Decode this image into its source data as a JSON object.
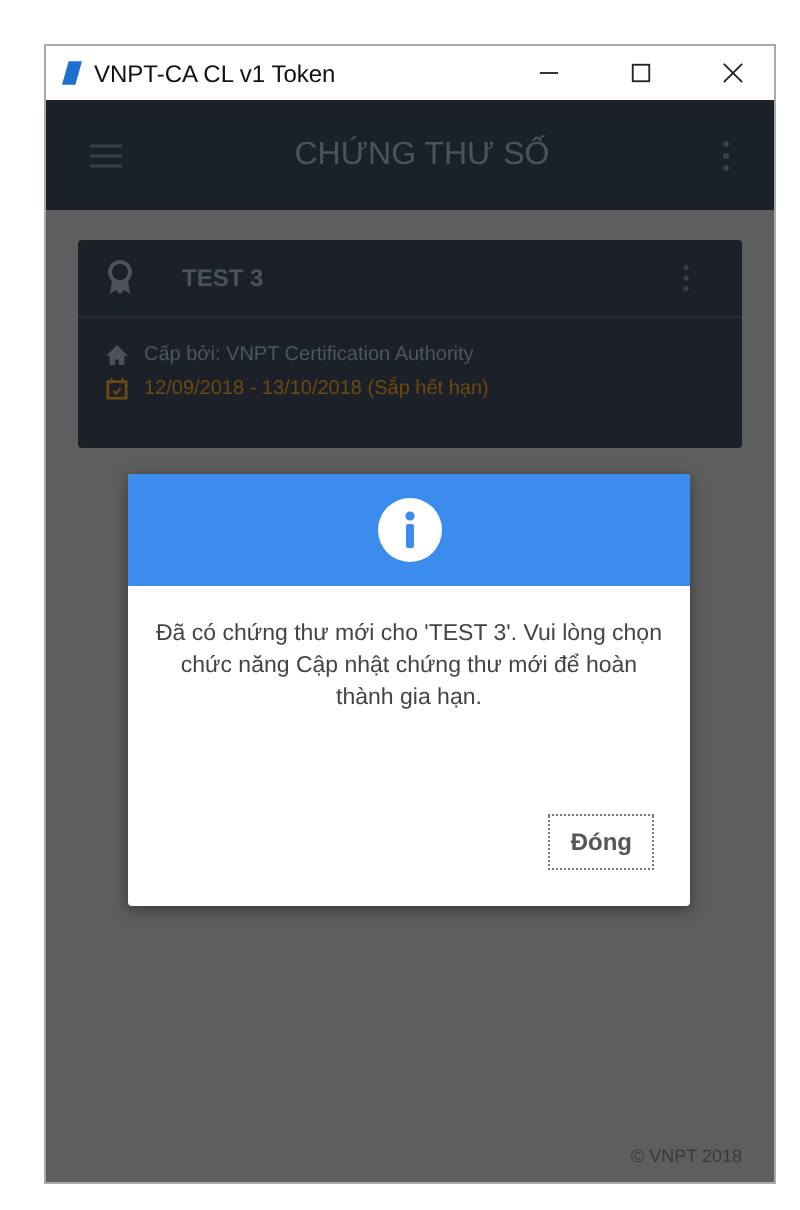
{
  "window": {
    "title": "VNPT-CA CL v1 Token"
  },
  "app_bar": {
    "title": "CHỨNG THƯ SỐ"
  },
  "certificate": {
    "name": "TEST 3",
    "issuer": "Cấp bởi: VNPT Certification Authority",
    "validity": "12/09/2018 - 13/10/2018 (Sắp hết hạn)"
  },
  "dialog": {
    "message": "Đã có chứng thư mới cho 'TEST 3'. Vui lòng chọn chức năng Cập nhật chứng thư mới để hoàn thành gia hạn.",
    "button": "Đóng"
  },
  "footer": "© VNPT 2018"
}
